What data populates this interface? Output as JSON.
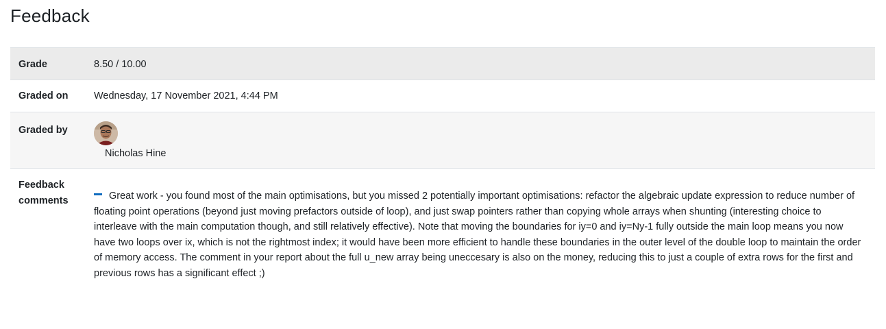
{
  "heading": "Feedback",
  "rows": {
    "grade": {
      "label": "Grade",
      "value": "8.50 / 10.00"
    },
    "graded_on": {
      "label": "Graded on",
      "value": "Wednesday, 17 November 2021, 4:44 PM"
    },
    "graded_by": {
      "label": "Graded by",
      "name": "Nicholas Hine",
      "avatar_icon": "user-avatar"
    },
    "comments": {
      "label_line1": "Feedback",
      "label_line2": "comments",
      "toggle_icon": "minus-icon",
      "text": "Great work - you found most of the main optimisations, but you missed 2 potentially important optimisations: refactor the algebraic update expression to reduce number of floating point operations (beyond just moving prefactors outside of loop), and just swap pointers rather than copying whole arrays when shunting (interesting choice to interleave with the main computation though, and still relatively effective). Note that moving the boundaries for iy=0 and iy=Ny-1 fully outside the main loop means you now have two loops over ix, which is not the rightmost index; it would have been more efficient to handle these boundaries in the outer level of the double loop to maintain the order of memory access. The comment in your report about the full u_new array being uneccesary is also on the money, reducing this to just a couple of extra rows for the first and previous rows has a significant effect ;)"
    }
  },
  "colors": {
    "accent": "#0f6cbf",
    "grade_row_bg": "#ebebeb",
    "graded_by_row_bg": "#f6f6f6",
    "border": "#dee2e6"
  }
}
